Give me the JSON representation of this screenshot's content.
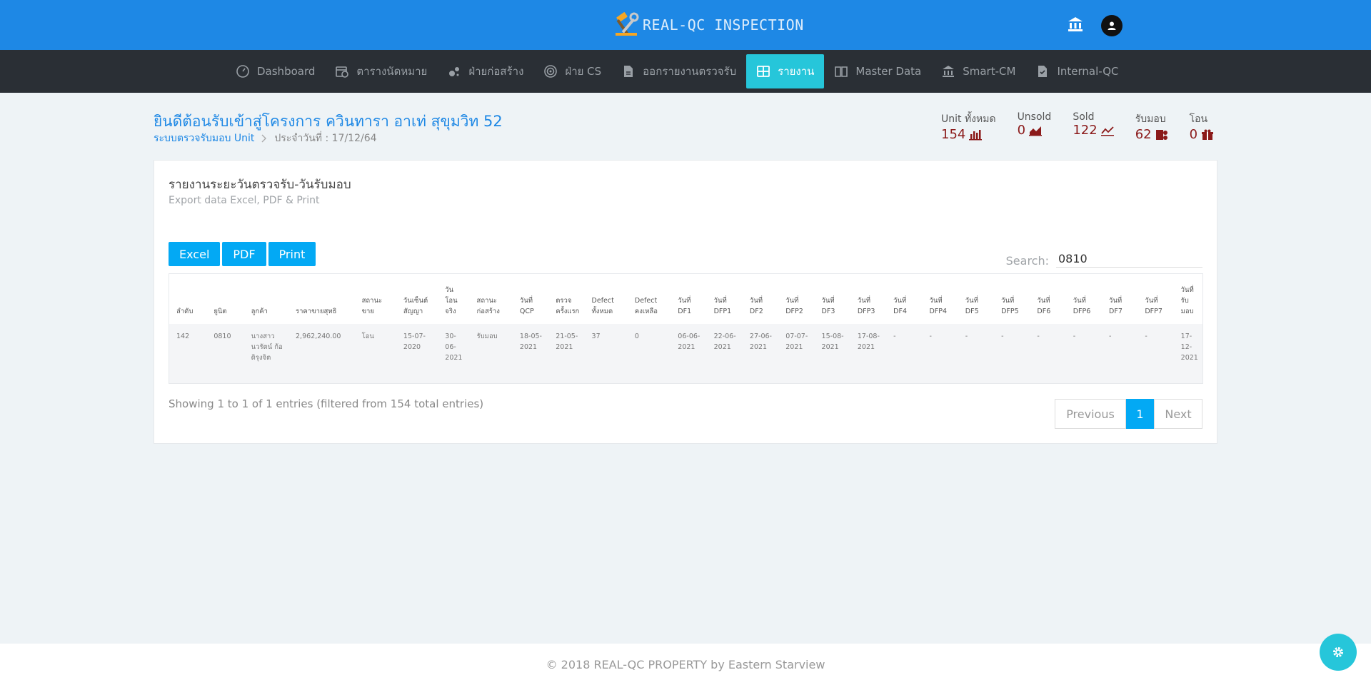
{
  "header": {
    "brand": "REAL-QC INSPECTION",
    "brand_logo_icon": "hammer-wrench-icon",
    "bank_icon": "bank-icon",
    "avatar_icon": "user-avatar-icon",
    "color": "#1e88e5"
  },
  "nav": {
    "items": [
      {
        "label": "Dashboard",
        "icon": "gauge-icon"
      },
      {
        "label": "ตารางนัดหมาย",
        "icon": "calendar-clock-icon"
      },
      {
        "label": "ฝ่ายก่อสร้าง",
        "icon": "bubbles-icon"
      },
      {
        "label": "ฝ่าย CS",
        "icon": "target-icon"
      },
      {
        "label": "ออกรายงานตรวจรับ",
        "icon": "document-icon"
      },
      {
        "label": "รายงาน",
        "icon": "table-icon",
        "active": true
      },
      {
        "label": "Master Data",
        "icon": "book-icon"
      },
      {
        "label": "Smart-CM",
        "icon": "bank-icon"
      },
      {
        "label": "Internal-QC",
        "icon": "doc-check-icon"
      }
    ],
    "active_color": "#26c6da"
  },
  "page": {
    "title": "ยินดีต้อนรับเข้าสู่โครงการ ควินทารา อาเท่ สุขุมวิท 52",
    "breadcrumb_link": "ระบบตรวจรับมอบ Unit",
    "breadcrumb_date": "ประจำวันที่ : 17/12/64"
  },
  "stats": [
    {
      "label": "Unit ทั้งหมด",
      "value": "154",
      "icon": "bar-chart-icon"
    },
    {
      "label": "Unsold",
      "value": "0",
      "icon": "area-chart-icon"
    },
    {
      "label": "Sold",
      "value": "122",
      "icon": "line-chart-icon"
    },
    {
      "label": "รับมอบ",
      "value": "62",
      "icon": "users-icon"
    },
    {
      "label": "โอน",
      "value": "0",
      "icon": "gift-icon"
    }
  ],
  "stat_color": "#8b1a1a",
  "card": {
    "title": "รายงานระยะวันตรวจรับ-วันรับมอบ",
    "subtitle": "Export data Excel, PDF & Print",
    "buttons": {
      "excel": "Excel",
      "pdf": "PDF",
      "print": "Print"
    },
    "search_label": "Search:",
    "search_value": "0810"
  },
  "table": {
    "columns": [
      "ลำดับ",
      "ยูนิต",
      "ลูกค้า",
      "ราคาขายสุทธิ",
      "สถานะขาย",
      "วันเซ็นต์สัญญา",
      "วันโอนจริง",
      "สถานะก่อสร้าง",
      "วันที่ QCP",
      "ตรวจครั้งแรก",
      "Defect ทั้งหมด",
      "Defect คงเหลือ",
      "วันที่ DF1",
      "วันที่ DFP1",
      "วันที่ DF2",
      "วันที่ DFP2",
      "วันที่ DF3",
      "วันที่ DFP3",
      "วันที่ DF4",
      "วันที่ DFP4",
      "วันที่ DF5",
      "วันที่ DFP5",
      "วันที่ DF6",
      "วันที่ DFP6",
      "วันที่ DF7",
      "วันที่ DFP7",
      "วันที่รับมอบ"
    ],
    "rows": [
      [
        "142",
        "0810",
        "นางสาวนวรัตน์ ก้อดิรุงจิต",
        "2,962,240.00",
        "โอน",
        "15-07-2020",
        "30-06-2021",
        "รับมอบ",
        "18-05-2021",
        "21-05-2021",
        "37",
        "0",
        "06-06-2021",
        "22-06-2021",
        "27-06-2021",
        "07-07-2021",
        "15-08-2021",
        "17-08-2021",
        "-",
        "-",
        "-",
        "-",
        "-",
        "-",
        "-",
        "-",
        "17-12-2021"
      ]
    ]
  },
  "pagination": {
    "info": "Showing 1 to 1 of 1 entries (filtered from 154 total entries)",
    "previous": "Previous",
    "current": "1",
    "next": "Next"
  },
  "footer": {
    "text": "© 2018 REAL-QC PROPERTY by Eastern Starview"
  },
  "fab_icon": "gear-icon"
}
